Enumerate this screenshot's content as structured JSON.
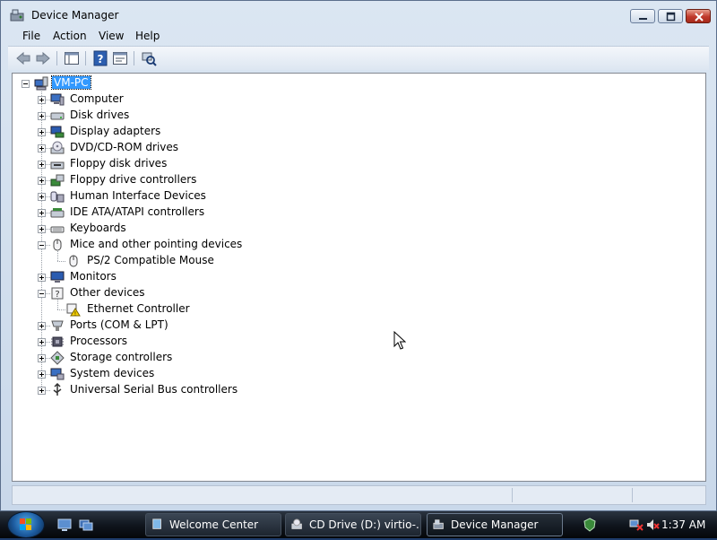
{
  "window": {
    "title": "Device Manager"
  },
  "menu": {
    "file": "File",
    "action": "Action",
    "view": "View",
    "help": "Help"
  },
  "toolbar": {
    "icons": [
      "back-arrow-icon",
      "forward-arrow-icon",
      "show-hide-console-tree-icon",
      "help-icon",
      "properties-icon",
      "scan-hardware-icon"
    ]
  },
  "tree": {
    "root": "VM-PC",
    "items": [
      {
        "label": "Computer",
        "icon": "computer-icon",
        "expanded": false
      },
      {
        "label": "Disk drives",
        "icon": "disk-drive-icon",
        "expanded": false
      },
      {
        "label": "Display adapters",
        "icon": "display-adapter-icon",
        "expanded": false
      },
      {
        "label": "DVD/CD-ROM drives",
        "icon": "dvd-drive-icon",
        "expanded": false
      },
      {
        "label": "Floppy disk drives",
        "icon": "floppy-drive-icon",
        "expanded": false
      },
      {
        "label": "Floppy drive controllers",
        "icon": "floppy-controller-icon",
        "expanded": false
      },
      {
        "label": "Human Interface Devices",
        "icon": "hid-icon",
        "expanded": false
      },
      {
        "label": "IDE ATA/ATAPI controllers",
        "icon": "ide-controller-icon",
        "expanded": false
      },
      {
        "label": "Keyboards",
        "icon": "keyboard-icon",
        "expanded": false
      },
      {
        "label": "Mice and other pointing devices",
        "icon": "mouse-icon",
        "expanded": true,
        "children": [
          {
            "label": "PS/2 Compatible Mouse",
            "icon": "mouse-icon"
          }
        ]
      },
      {
        "label": "Monitors",
        "icon": "monitor-icon",
        "expanded": false
      },
      {
        "label": "Other devices",
        "icon": "unknown-device-icon",
        "expanded": true,
        "children": [
          {
            "label": "Ethernet Controller",
            "icon": "warning-device-icon"
          }
        ]
      },
      {
        "label": "Ports (COM & LPT)",
        "icon": "port-icon",
        "expanded": false
      },
      {
        "label": "Processors",
        "icon": "processor-icon",
        "expanded": false
      },
      {
        "label": "Storage controllers",
        "icon": "storage-controller-icon",
        "expanded": false
      },
      {
        "label": "System devices",
        "icon": "system-device-icon",
        "expanded": false
      },
      {
        "label": "Universal Serial Bus controllers",
        "icon": "usb-icon",
        "expanded": false
      }
    ]
  },
  "taskbar": {
    "tasks": [
      {
        "label": "Welcome Center",
        "icon": "welcome-center-icon",
        "active": false
      },
      {
        "label": "CD Drive (D:) virtio-...",
        "icon": "cd-drive-icon",
        "active": false
      },
      {
        "label": "Device Manager",
        "icon": "device-manager-icon",
        "active": true
      }
    ],
    "clock": "1:37 AM",
    "tray_icons": [
      "windows-defender-icon",
      "network-disconnected-icon",
      "volume-muted-icon"
    ]
  },
  "colors": {
    "selection": "#3399ff",
    "window_frame": "#c9d8ea",
    "taskbar": "#10161e"
  }
}
